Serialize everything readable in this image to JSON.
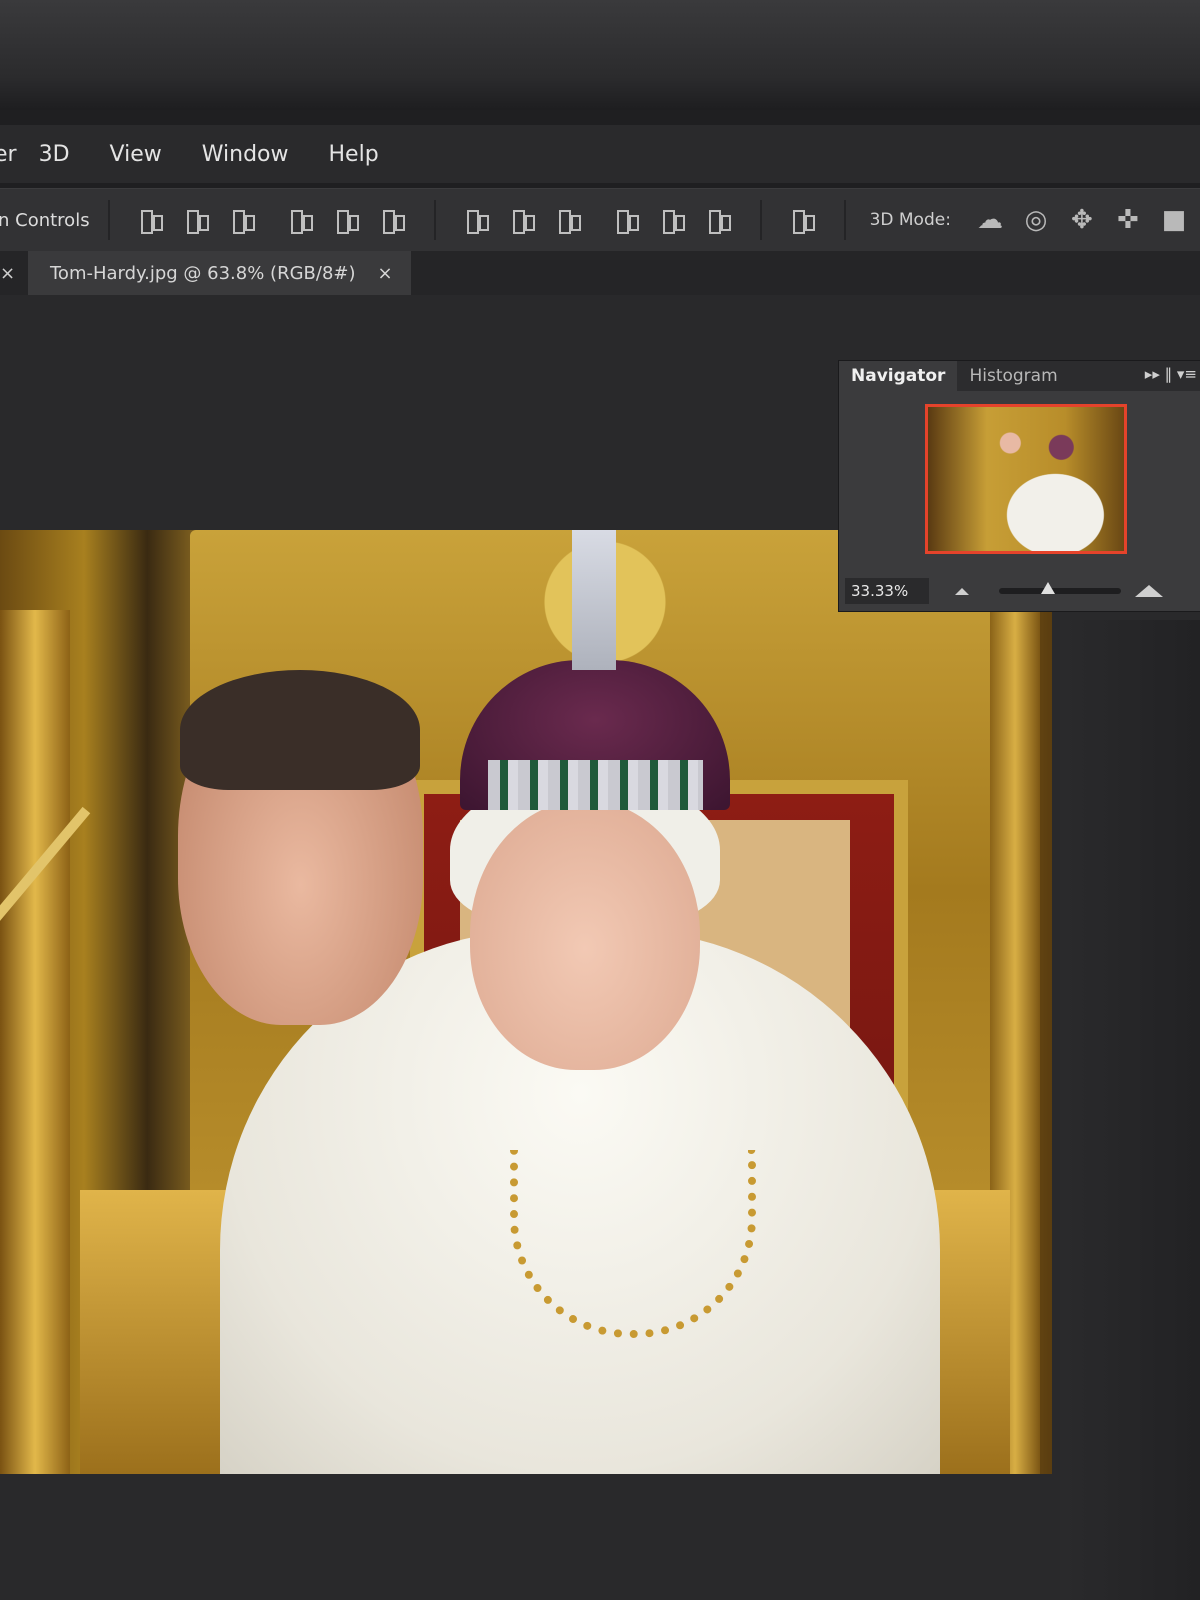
{
  "menu": {
    "items": [
      "er",
      "3D",
      "View",
      "Window",
      "Help"
    ]
  },
  "options_bar": {
    "controls_label": "n Controls",
    "mode_label": "3D Mode:",
    "align_icons": [
      "align-top-icon",
      "align-vertical-center-icon",
      "align-bottom-icon",
      "align-left-icon",
      "align-horizontal-center-icon",
      "align-right-icon",
      "distribute-top-icon",
      "distribute-vertical-center-icon",
      "distribute-bottom-icon",
      "distribute-left-icon",
      "distribute-horizontal-center-icon",
      "distribute-right-icon",
      "auto-align-icon"
    ],
    "mode_icons": [
      "orbit-icon",
      "roll-icon",
      "pan-icon",
      "slide-icon",
      "camera-icon"
    ]
  },
  "document": {
    "tab_title": "Tom-Hardy.jpg @ 63.8% (RGB/8#)",
    "close_symbol": "×",
    "left_close_symbol": "×"
  },
  "navigator": {
    "tabs": [
      "Navigator",
      "Histogram"
    ],
    "active_tab": "Navigator",
    "panel_actions": "▸▸ ‖ ▾≡",
    "zoom_value": "33.33%",
    "zoom_slider_level": 0.4,
    "view_box_color": "#e5432b"
  }
}
